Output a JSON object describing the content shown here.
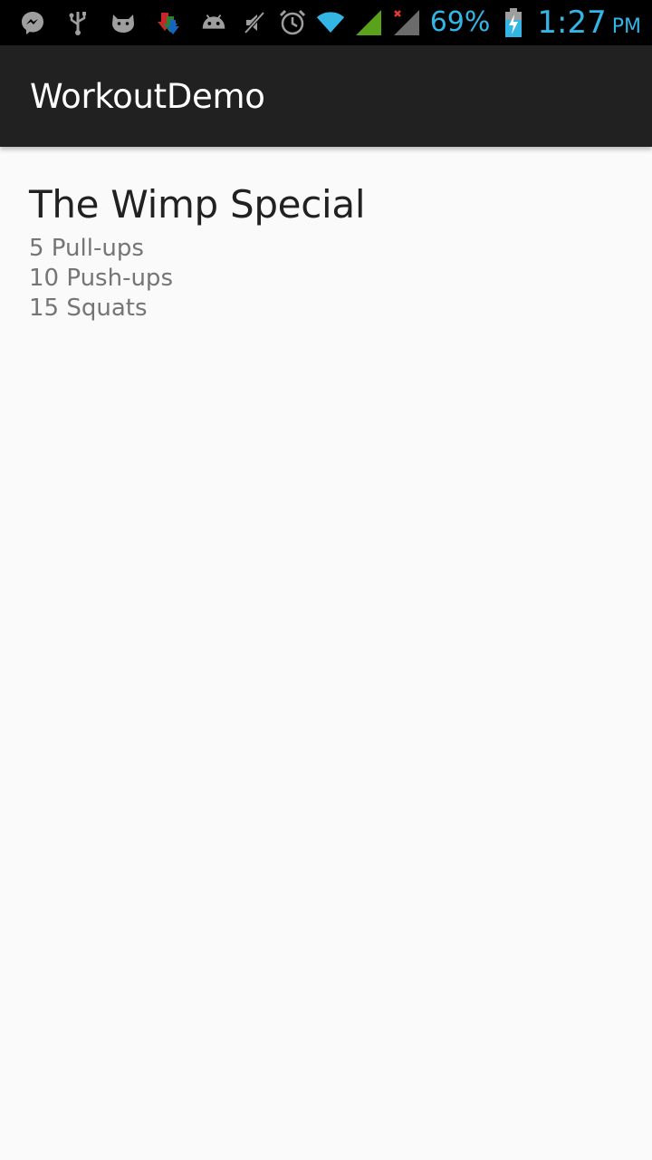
{
  "status_bar": {
    "left_icons": [
      "messenger-icon",
      "usb-icon",
      "cat-app-icon",
      "download-icon",
      "android-icon"
    ],
    "right_icons": [
      "mute-icon",
      "alarm-icon",
      "wifi-icon",
      "signal-icon",
      "no-signal-icon",
      "battery-charging-icon"
    ],
    "battery_percent": "69%",
    "time": "1:27",
    "ampm": "PM",
    "accent_color": "#33b5e5"
  },
  "action_bar": {
    "title": "WorkoutDemo",
    "background": "#212121"
  },
  "workout": {
    "name": "The Wimp Special",
    "exercises": [
      {
        "text": "5 Pull-ups"
      },
      {
        "text": "10 Push-ups"
      },
      {
        "text": "15 Squats"
      }
    ]
  }
}
